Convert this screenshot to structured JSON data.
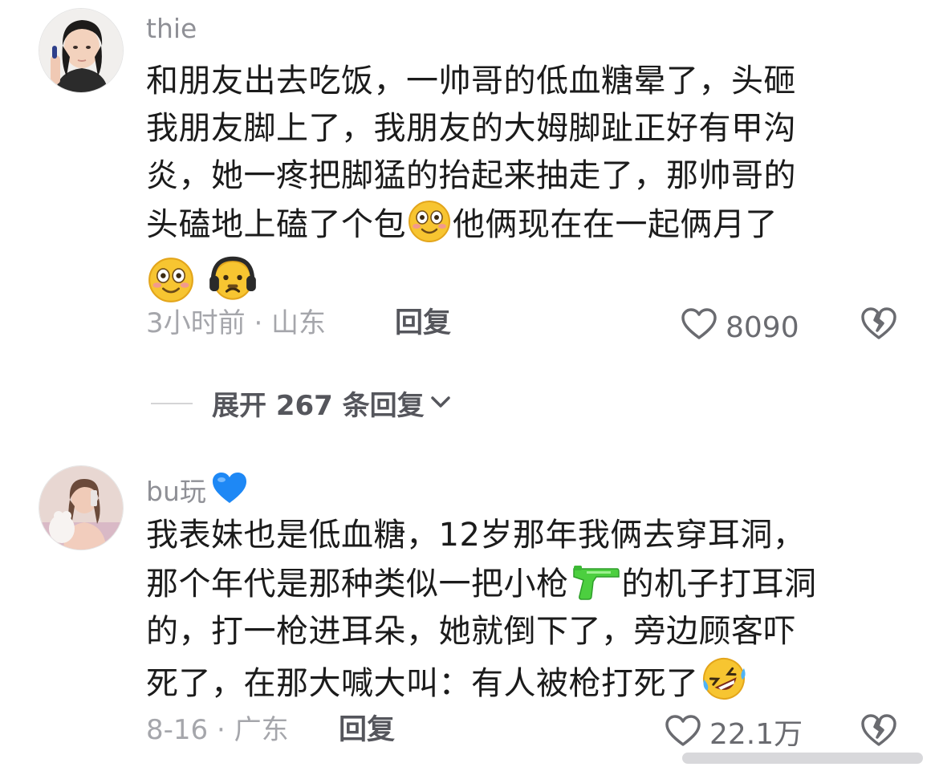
{
  "comments": [
    {
      "username": "thie",
      "line1": "和朋友出去吃饭，一帅哥的低血糖晕了，头砸",
      "line2": "我朋友脚上了，我朋友的大姆脚趾正好有甲沟",
      "line3": "炎，她一疼把脚猛的抬起来抽走了，那帅哥的",
      "line4_a": "头磕地上磕了个包",
      "line4_b": "他俩现在在一起俩月了",
      "time_location": "3小时前 · 山东",
      "reply_label": "回复",
      "likes": "8090",
      "emoji_icons": [
        "smile-icon",
        "smile-icon",
        "headphones-face-icon"
      ]
    },
    {
      "username": "bu玩",
      "line1": "我表妹也是低血糖，12岁那年我俩去穿耳洞，",
      "line2_a": "那个年代是那种类似一把小枪",
      "line2_b": "的机子打耳洞",
      "line3": "的，打一枪进耳朵，她就倒下了，旁边顾客吓",
      "line4": "死了，在那大喊大叫：有人被枪打死了",
      "time_location": "8-16 · 广东",
      "reply_label": "回复",
      "likes": "22.1万",
      "emoji_icons": [
        "blue-heart-icon",
        "water-gun-icon",
        "rofl-icon"
      ]
    }
  ],
  "expand_replies": "展开 267 条回复",
  "colors": {
    "text": "#1b1b1b",
    "username": "#8f9096",
    "meta": "#a5a6ab",
    "reply": "#55565c",
    "blue_heart": "#1e88f5",
    "water_gun": "#4ccf3f",
    "emoji_yellow": "#f7c531"
  }
}
